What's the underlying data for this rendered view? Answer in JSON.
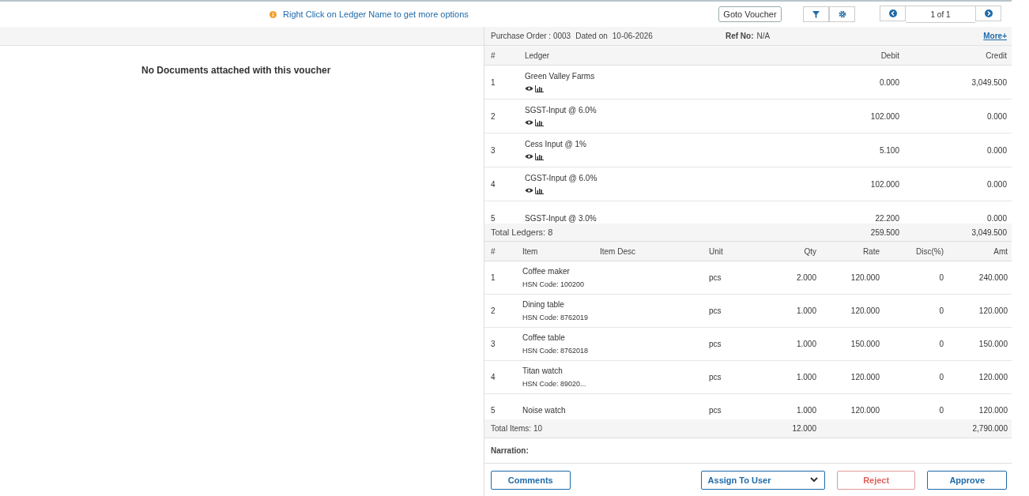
{
  "top_bar": {
    "hint": "Right Click on Ledger Name to get more options",
    "goto_button": "Goto Voucher",
    "pager": "1 of 1"
  },
  "documents": {
    "message": "No Documents attached with this voucher"
  },
  "voucher": {
    "title": "Purchase Order : 0003",
    "dated_label": "Dated on",
    "date": "10-06-2026",
    "ref_label": "Ref No:",
    "ref_value": "N/A",
    "more_link": "More+"
  },
  "ledgers": {
    "columns": [
      "#",
      "Ledger",
      "Debit",
      "Credit"
    ],
    "rows": [
      {
        "index": "1",
        "name": "Green Valley Farms",
        "debit": "0.000",
        "credit": "3,049.500",
        "icons": true
      },
      {
        "index": "2",
        "name": "SGST-Input @ 6.0%",
        "debit": "102.000",
        "credit": "0.000",
        "icons": true
      },
      {
        "index": "3",
        "name": "Cess Input @ 1%",
        "debit": "5.100",
        "credit": "0.000",
        "icons": true
      },
      {
        "index": "4",
        "name": "CGST-Input @ 6.0%",
        "debit": "102.000",
        "credit": "0.000",
        "icons": true
      },
      {
        "index": "5",
        "name": "SGST-Input @ 3.0%",
        "debit": "22.200",
        "credit": "0.000",
        "icons": false
      }
    ],
    "total_label": "Total Ledgers: 8",
    "total_debit": "259.500",
    "total_credit": "3,049.500"
  },
  "items": {
    "columns": [
      "#",
      "Item",
      "Item Desc",
      "Unit",
      "Qty",
      "Rate",
      "Disc(%)",
      "Amt"
    ],
    "rows": [
      {
        "index": "1",
        "name": "Coffee maker",
        "hsn": "HSN Code: 100200",
        "unit": "pcs",
        "qty": "2.000",
        "rate": "120.000",
        "disc": "0",
        "amt": "240.000"
      },
      {
        "index": "2",
        "name": "Dining table",
        "hsn": "HSN Code: 8762019",
        "unit": "pcs",
        "qty": "1.000",
        "rate": "120.000",
        "disc": "0",
        "amt": "120.000"
      },
      {
        "index": "3",
        "name": "Coffee table",
        "hsn": "HSN Code: 8762018",
        "unit": "pcs",
        "qty": "1.000",
        "rate": "150.000",
        "disc": "0",
        "amt": "150.000"
      },
      {
        "index": "4",
        "name": "Titan watch",
        "hsn": "HSN Code: 89020...",
        "unit": "pcs",
        "qty": "1.000",
        "rate": "120.000",
        "disc": "0",
        "amt": "120.000"
      },
      {
        "index": "5",
        "name": "Noise watch",
        "unit": "pcs",
        "qty": "1.000",
        "rate": "120.000",
        "disc": "0",
        "amt": "120.000"
      }
    ],
    "total_label": "Total Items: 10",
    "total_qty": "12.000",
    "total_amt": "2,790.000"
  },
  "narration_label": "Narration:",
  "actions": {
    "comments": "Comments",
    "assign": "Assign To User",
    "reject": "Reject",
    "approve": "Approve"
  }
}
